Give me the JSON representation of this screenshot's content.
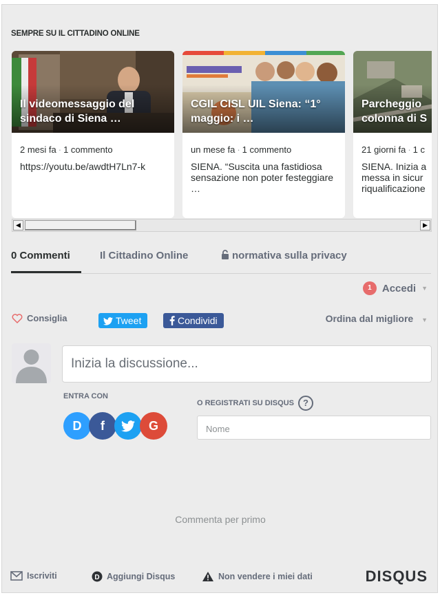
{
  "section_title": "SEMPRE SU IL CITTADINO ONLINE",
  "cards": [
    {
      "title": "Il videomessaggio del sindaco di Siena …",
      "age": "2 mesi fa",
      "comments": "1 commento",
      "excerpt": "https://youtu.be/awdtH7Ln7-k"
    },
    {
      "title": "CGIL CISL UIL Siena: “1° maggio: i …",
      "age": "un mese fa",
      "comments": "1 commento",
      "excerpt": "SIENA. “Suscita una fastidiosa sensazione non poter festeggiare …"
    },
    {
      "title": "Parcheggio colonna di S",
      "age": "21 giorni fa",
      "comments": "1 c",
      "excerpt": "SIENA. Inizia a messa in sicur riqualificazione"
    }
  ],
  "tabs": {
    "comments": "0 Commenti",
    "site": "Il Cittadino Online",
    "privacy": "normativa sulla privacy"
  },
  "login": {
    "badge": "1",
    "label": "Accedi"
  },
  "actions": {
    "recommend": "Consiglia",
    "tweet": "Tweet",
    "share": "Condividi",
    "sort": "Ordina dal migliore"
  },
  "composer": {
    "placeholder": "Inizia la discussione..."
  },
  "login_with": "ENTRA CON",
  "social": [
    {
      "name": "disqus",
      "glyph": "D",
      "color": "#2e9fff"
    },
    {
      "name": "facebook",
      "glyph": "f",
      "color": "#3b5998"
    },
    {
      "name": "twitter",
      "glyph": "",
      "color": "#1da1f2"
    },
    {
      "name": "google",
      "glyph": "G",
      "color": "#dd4b39"
    }
  ],
  "register_label": "O REGISTRATI SU DISQUS",
  "name_placeholder": "Nome",
  "empty_message": "Commenta per primo",
  "footer": {
    "subscribe": "Iscriviti",
    "add_disqus": "Aggiungi Disqus",
    "do_not_sell": "Non vendere i miei dati",
    "brand": "DISQUS"
  },
  "colors": {
    "background": "#ececec",
    "twitter": "#1da1f2",
    "facebook": "#3b5998",
    "badge": "#e76c6c",
    "heart": "#e76c6c"
  },
  "icons": [
    "lock-icon",
    "heart-icon",
    "twitter-icon",
    "facebook-icon",
    "mail-icon",
    "disqus-d-icon",
    "warning-icon",
    "help-icon"
  ]
}
